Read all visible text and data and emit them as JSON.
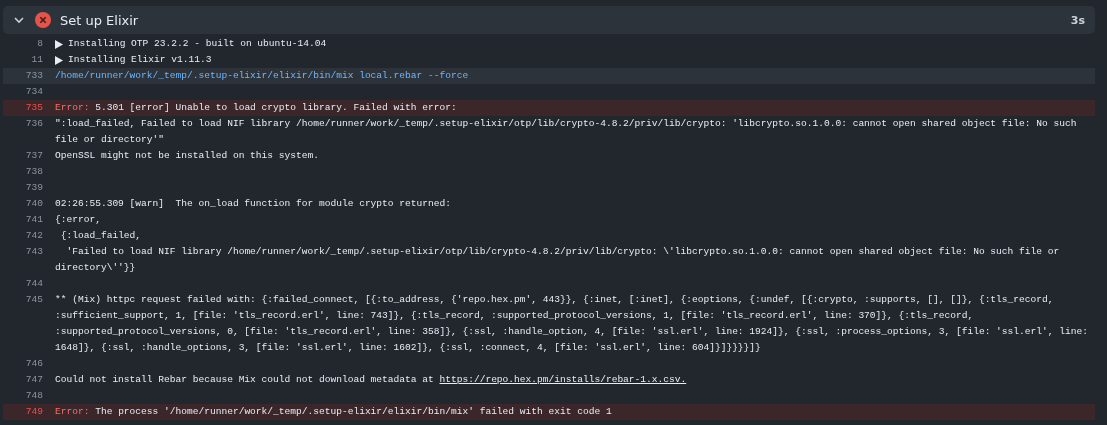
{
  "step": {
    "title": "Set up Elixir",
    "failed": true,
    "expanded": true,
    "duration": "3s"
  },
  "log_lines": [
    {
      "number": "8",
      "kind": "group",
      "expanded": false,
      "text": "Installing OTP 23.2.2 - built on ubuntu-14.04"
    },
    {
      "number": "11",
      "kind": "group",
      "expanded": false,
      "text": "Installing Elixir v1.11.3"
    },
    {
      "number": "733",
      "kind": "command",
      "text": "/home/runner/work/_temp/.setup-elixir/elixir/bin/mix local.rebar --force"
    },
    {
      "number": "734",
      "kind": "blank"
    },
    {
      "number": "735",
      "kind": "error",
      "prefix": "Error:",
      "text": "5.301 [error] Unable to load crypto library. Failed with error:"
    },
    {
      "number": "736",
      "kind": "normal",
      "text": "\":load_failed, Failed to load NIF library /home/runner/work/_temp/.setup-elixir/otp/lib/crypto-4.8.2/priv/lib/crypto: 'libcrypto.so.1.0.0: cannot open shared object file: No such file or directory'\""
    },
    {
      "number": "737",
      "kind": "normal",
      "text": "OpenSSL might not be installed on this system."
    },
    {
      "number": "738",
      "kind": "blank"
    },
    {
      "number": "739",
      "kind": "blank"
    },
    {
      "number": "740",
      "kind": "normal",
      "text": "02:26:55.309 [warn]  The on_load function for module crypto returned:"
    },
    {
      "number": "741",
      "kind": "normal",
      "text": "{:error,"
    },
    {
      "number": "742",
      "kind": "normal",
      "text": " {:load_failed,"
    },
    {
      "number": "743",
      "kind": "normal",
      "text": "  'Failed to load NIF library /home/runner/work/_temp/.setup-elixir/otp/lib/crypto-4.8.2/priv/lib/crypto: \\'libcrypto.so.1.0.0: cannot open shared object file: No such file or directory\\''}}"
    },
    {
      "number": "744",
      "kind": "blank"
    },
    {
      "number": "745",
      "kind": "normal",
      "text": "** (Mix) httpc request failed with: {:failed_connect, [{:to_address, {'repo.hex.pm', 443}}, {:inet, [:inet], {:eoptions, {:undef, [{:crypto, :supports, [], []}, {:tls_record, :sufficient_support, 1, [file: 'tls_record.erl', line: 743]}, {:tls_record, :supported_protocol_versions, 1, [file: 'tls_record.erl', line: 370]}, {:tls_record, :supported_protocol_versions, 0, [file: 'tls_record.erl', line: 358]}, {:ssl, :handle_option, 4, [file: 'ssl.erl', line: 1924]}, {:ssl, :process_options, 3, [file: 'ssl.erl', line: 1648]}, {:ssl, :handle_options, 3, [file: 'ssl.erl', line: 1602]}, {:ssl, :connect, 4, [file: 'ssl.erl', line: 604]}]}}}}]}"
    },
    {
      "number": "746",
      "kind": "blank"
    },
    {
      "number": "747",
      "kind": "normal",
      "text": "Could not install Rebar because Mix could not download metadata at ",
      "link": "https://repo.hex.pm/installs/rebar-1.x.csv."
    },
    {
      "number": "748",
      "kind": "blank"
    },
    {
      "number": "749",
      "kind": "error",
      "prefix": "Error:",
      "text": "The process '/home/runner/work/_temp/.setup-elixir/elixir/bin/mix' failed with exit code 1"
    }
  ]
}
